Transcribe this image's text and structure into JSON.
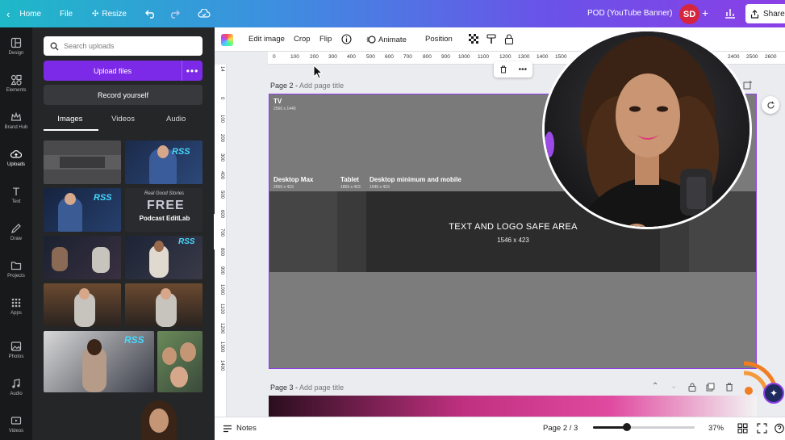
{
  "topbar": {
    "home": "Home",
    "file": "File",
    "resize": "Resize",
    "document_title": "POD (YouTube Banner)",
    "avatar_initials": "SD",
    "share": "Share"
  },
  "rail": {
    "items": [
      {
        "label": "Design",
        "icon": "layout-icon"
      },
      {
        "label": "Elements",
        "icon": "shapes-icon"
      },
      {
        "label": "Brand Hub",
        "icon": "crown-icon"
      },
      {
        "label": "Uploads",
        "icon": "cloud-upload-icon",
        "active": true
      },
      {
        "label": "Text",
        "icon": "text-t-icon"
      },
      {
        "label": "Draw",
        "icon": "pen-icon"
      },
      {
        "label": "Projects",
        "icon": "folder-icon"
      },
      {
        "label": "Apps",
        "icon": "grid-icon"
      },
      {
        "label": "Photos",
        "icon": "image-icon"
      },
      {
        "label": "Audio",
        "icon": "music-note-icon"
      },
      {
        "label": "Videos",
        "icon": "video-icon"
      }
    ]
  },
  "uploads": {
    "search_placeholder": "Search uploads",
    "upload_button": "Upload files",
    "more": "•••",
    "record_button": "Record yourself",
    "tabs": [
      "Images",
      "Videos",
      "Audio"
    ],
    "thumb_text": {
      "rss": "RSS",
      "free_script": "Real Good Stories",
      "free": "FREE",
      "podcast_editlab": "Podcast EditLab"
    }
  },
  "context_toolbar": {
    "edit_image": "Edit image",
    "crop": "Crop",
    "flip": "Flip",
    "animate": "Animate",
    "position": "Position"
  },
  "ruler": {
    "top": [
      "0",
      "100",
      "200",
      "300",
      "400",
      "500",
      "600",
      "700",
      "800",
      "900",
      "1000",
      "1100",
      "1200",
      "1300",
      "1400",
      "1500",
      "2400",
      "2500",
      "2600"
    ],
    "left": [
      "14",
      "0",
      "100",
      "200",
      "300",
      "400",
      "500",
      "600",
      "700",
      "800",
      "900",
      "1000",
      "1100",
      "1200",
      "1300",
      "1400"
    ]
  },
  "page2": {
    "label": "Page 2 -",
    "placeholder": "Add page title",
    "tv_label": "TV",
    "tv_size": "2560 x 1440",
    "desktop_max_label": "Desktop Max",
    "desktop_max_size": "2560 x 423",
    "tablet_label": "Tablet",
    "tablet_size": "1855 x 423",
    "desktop_min_label": "Desktop minimum and mobile",
    "desktop_min_size": "1546 x 423",
    "safe_area_title": "TEXT AND LOGO SAFE AREA",
    "safe_area_size": "1546 x 423"
  },
  "page3": {
    "label": "Page 3 -",
    "placeholder": "Add page title"
  },
  "bottombar": {
    "notes": "Notes",
    "page_indicator": "Page 2 / 3",
    "zoom": "37%",
    "zoom_fraction": 0.33
  },
  "colors": {
    "accent_purple": "#7d2ae8",
    "selection": "#8b3fe6",
    "avatar_red": "#d6263e"
  }
}
